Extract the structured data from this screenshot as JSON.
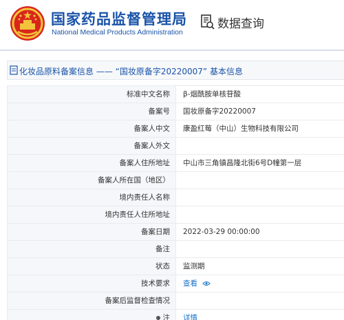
{
  "header": {
    "brand_cn": "国家药品监督管理局",
    "brand_en": "National Medical Products Administration",
    "query_title": "数据查询",
    "brand_color": "#1a53a8"
  },
  "section": {
    "title": "化妆品原料备案信息 —— “国妆原备字20220007” 基本信息"
  },
  "fields": [
    {
      "label": "标准中文名称",
      "value": "β-烟酰胺单核苷酸"
    },
    {
      "label": "备案号",
      "value": "国妆原备字20220007"
    },
    {
      "label": "备案人中文",
      "value": "康盈红莓（中山）生物科技有限公司"
    },
    {
      "label": "备案人外文",
      "value": ""
    },
    {
      "label": "备案人住所地址",
      "value": "中山市三角镇昌隆北街6号D幢第一层"
    },
    {
      "label": "备案人所在国（地区）",
      "value": ""
    },
    {
      "label": "境内责任人名称",
      "value": ""
    },
    {
      "label": "境内责任人住所地址",
      "value": ""
    },
    {
      "label": "备案日期",
      "value": "2022-03-29 00:00:00"
    },
    {
      "label": "备注",
      "value": ""
    },
    {
      "label": "状态",
      "value": "监测期"
    },
    {
      "label": "技术要求",
      "value": "查看"
    },
    {
      "label": "备案后监督检查情况",
      "value": ""
    },
    {
      "label": "注",
      "value": "详情"
    }
  ],
  "icons": {
    "emblem": "national-emblem-icon",
    "query": "document-search-icon",
    "section": "document-icon",
    "view": "eye-icon"
  }
}
